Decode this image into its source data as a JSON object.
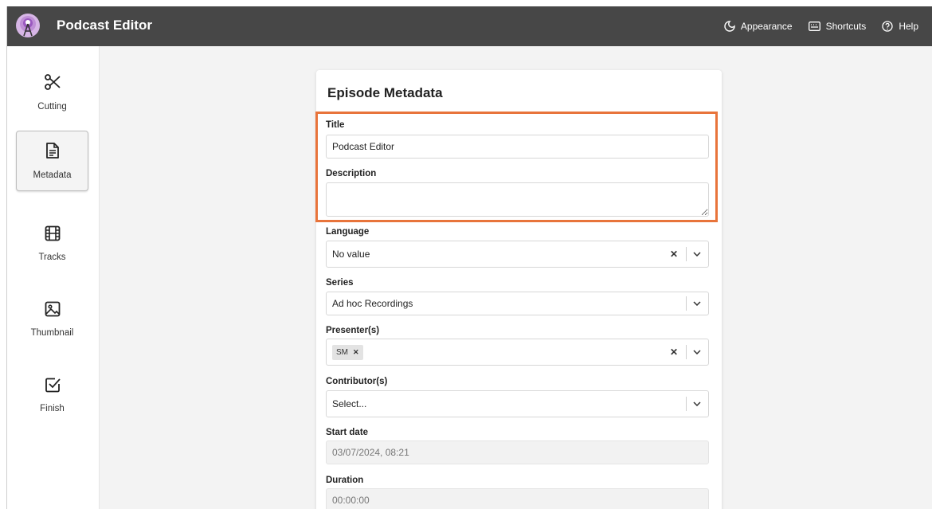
{
  "app": {
    "title": "Podcast Editor"
  },
  "header": {
    "appearance": "Appearance",
    "shortcuts": "Shortcuts",
    "help": "Help"
  },
  "sidebar": {
    "items": [
      {
        "label": "Cutting",
        "icon": "scissors-icon"
      },
      {
        "label": "Metadata",
        "icon": "document-icon",
        "active": true
      },
      {
        "label": "Tracks",
        "icon": "film-icon"
      },
      {
        "label": "Thumbnail",
        "icon": "image-icon"
      },
      {
        "label": "Finish",
        "icon": "check-square-icon"
      }
    ]
  },
  "metadata": {
    "heading": "Episode Metadata",
    "title_label": "Title",
    "title_value": "Podcast Editor",
    "description_label": "Description",
    "description_value": "",
    "language_label": "Language",
    "language_value": "No value",
    "series_label": "Series",
    "series_value": "Ad hoc Recordings",
    "presenters_label": "Presenter(s)",
    "presenter_chip": "SM",
    "contributors_label": "Contributor(s)",
    "contributors_placeholder": "Select...",
    "start_date_label": "Start date",
    "start_date_value": "03/07/2024, 08:21",
    "duration_label": "Duration",
    "duration_value": "00:00:00"
  },
  "colors": {
    "header_bg": "#474747",
    "highlight": "#e8743b"
  }
}
